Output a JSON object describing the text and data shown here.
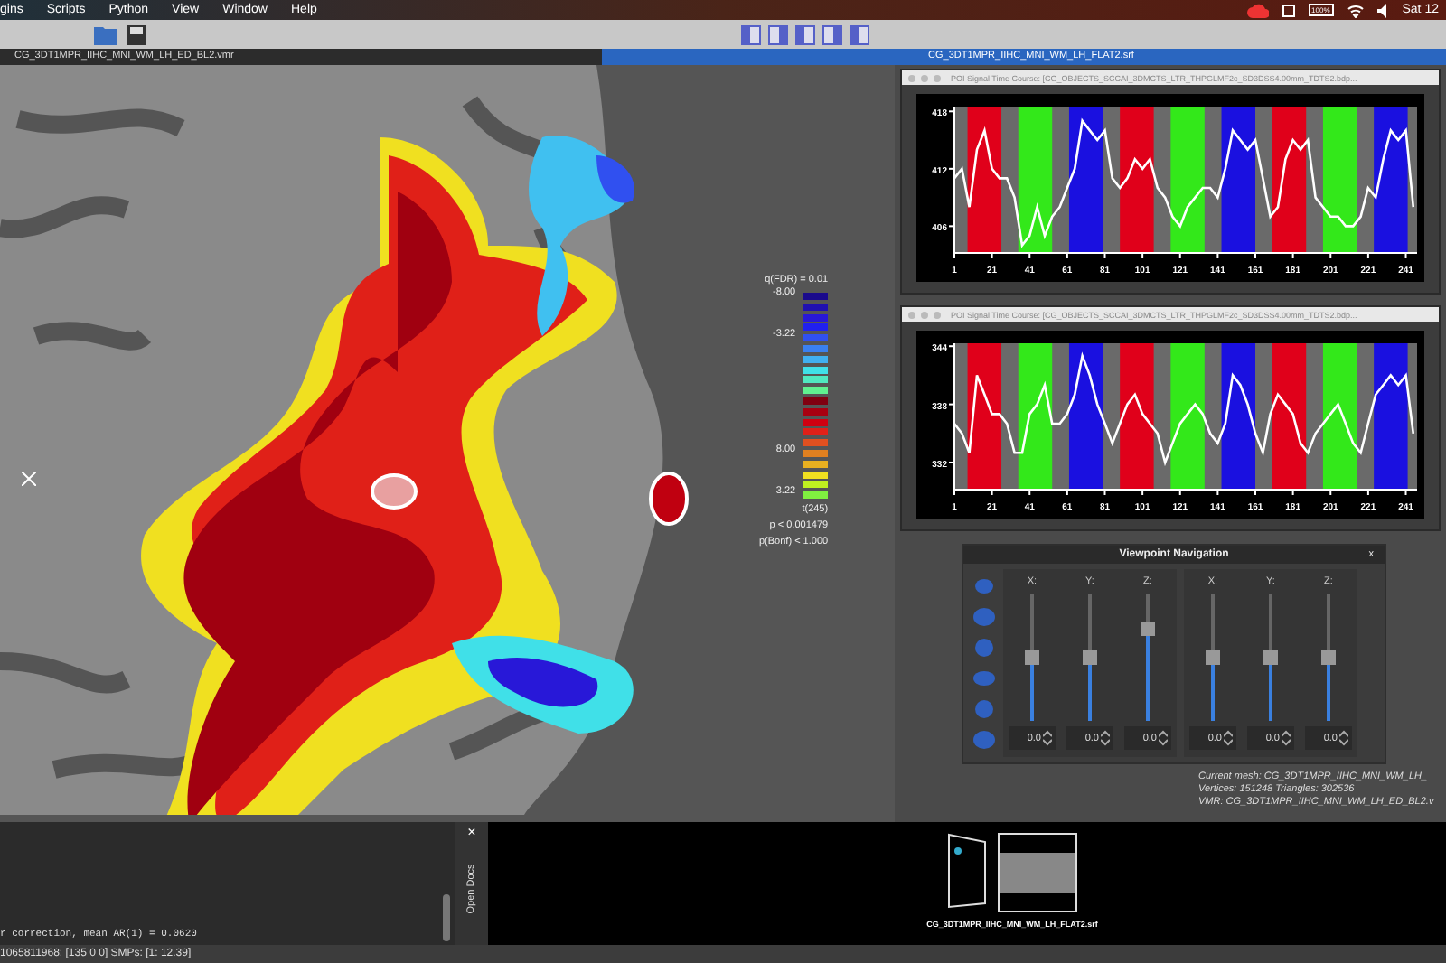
{
  "menu_bar": {
    "items": [
      "gins",
      "Scripts",
      "Python",
      "View",
      "Window",
      "Help"
    ],
    "battery": "100%",
    "clock": "Sat 12"
  },
  "tabs": [
    {
      "label": "CG_3DT1MPR_IIHC_MNI_WM_LH_ED_BL2.vmr",
      "selected": false
    },
    {
      "label": "CG_3DT1MPR_IIHC_MNI_WM_LH_FLAT2.srf",
      "selected": true
    }
  ],
  "legend": {
    "title": "q(FDR) = 0.01",
    "neg_max": "-8.00",
    "neg_min": "-3.22",
    "pos_max": "8.00",
    "pos_min": "3.22",
    "dof": "t(245)",
    "p_value": "p < 0.001479",
    "bonferroni": "p(Bonf) < 1.000",
    "negative_colors": [
      {
        "color": "#1a0a8c"
      },
      {
        "color": "#2010b0"
      },
      {
        "color": "#2818d8"
      },
      {
        "color": "#2020f0"
      },
      {
        "color": "#3050f0"
      },
      {
        "color": "#3a80f0"
      },
      {
        "color": "#40b0f0"
      },
      {
        "color": "#40e0e8"
      },
      {
        "color": "#50e8c0"
      },
      {
        "color": "#60f090"
      }
    ],
    "positive_colors": [
      {
        "color": "#800010"
      },
      {
        "color": "#a80010"
      },
      {
        "color": "#d00010"
      },
      {
        "color": "#e02018"
      },
      {
        "color": "#e05020"
      },
      {
        "color": "#e08020"
      },
      {
        "color": "#e8b020"
      },
      {
        "color": "#f0e020"
      },
      {
        "color": "#c0f020"
      },
      {
        "color": "#80f040"
      }
    ]
  },
  "time_courses": [
    {
      "title": "POI Signal Time Course: [CG_OBJECTS_SCCAI_3DMCTS_LTR_THPGLMF2c_SD3DSS4.00mm_TDTS2.bdp...",
      "chart_data": {
        "type": "line",
        "xlim": [
          1,
          247
        ],
        "ylim": [
          403.2,
          418.5
        ],
        "yticks": [
          406,
          412,
          418
        ],
        "xticks": [
          1,
          21,
          41,
          61,
          81,
          101,
          121,
          141,
          161,
          181,
          201,
          221,
          241
        ],
        "x": [
          1,
          5,
          9,
          13,
          17,
          21,
          25,
          29,
          33,
          37,
          41,
          45,
          49,
          53,
          57,
          61,
          65,
          69,
          73,
          77,
          81,
          85,
          89,
          93,
          97,
          101,
          105,
          109,
          113,
          117,
          121,
          125,
          129,
          133,
          137,
          141,
          145,
          149,
          153,
          157,
          161,
          165,
          169,
          173,
          177,
          181,
          185,
          189,
          193,
          197,
          201,
          205,
          209,
          213,
          217,
          221,
          225,
          229,
          233,
          237,
          241,
          245
        ],
        "series": [
          {
            "color": "#ffffff",
            "values": [
              411,
              412,
              408,
              414,
              416,
              412,
              411,
              411,
              409,
              404,
              405,
              408,
              405,
              407,
              408,
              410,
              412,
              417,
              416,
              415,
              416,
              411,
              410,
              411,
              413,
              412,
              413,
              410,
              409,
              407,
              406,
              408,
              409,
              410,
              410,
              409,
              412,
              416,
              415,
              414,
              415,
              411,
              407,
              408,
              413,
              415,
              414,
              415,
              409,
              408,
              407,
              407,
              406,
              406,
              407,
              410,
              409,
              413,
              416,
              415,
              416,
              408
            ]
          }
        ]
      },
      "condition_blocks": [
        {
          "color": "#e0001a"
        },
        {
          "color": "#33e81a"
        },
        {
          "color": "#1a10e0"
        },
        {
          "color": "#e0001a"
        },
        {
          "color": "#33e81a"
        },
        {
          "color": "#1a10e0"
        },
        {
          "color": "#e0001a"
        },
        {
          "color": "#33e81a"
        },
        {
          "color": "#1a10e0"
        }
      ]
    },
    {
      "title": "POI Signal Time Course: [CG_OBJECTS_SCCAI_3DMCTS_LTR_THPGLMF2c_SD3DSS4.00mm_TDTS2.bdp...",
      "chart_data": {
        "type": "line",
        "xlim": [
          1,
          247
        ],
        "ylim": [
          329.2,
          344.3
        ],
        "yticks": [
          332,
          338,
          344
        ],
        "xticks": [
          1,
          21,
          41,
          61,
          81,
          101,
          121,
          141,
          161,
          181,
          201,
          221,
          241
        ],
        "x": [
          1,
          5,
          9,
          13,
          17,
          21,
          25,
          29,
          33,
          37,
          41,
          45,
          49,
          53,
          57,
          61,
          65,
          69,
          73,
          77,
          81,
          85,
          89,
          93,
          97,
          101,
          105,
          109,
          113,
          117,
          121,
          125,
          129,
          133,
          137,
          141,
          145,
          149,
          153,
          157,
          161,
          165,
          169,
          173,
          177,
          181,
          185,
          189,
          193,
          197,
          201,
          205,
          209,
          213,
          217,
          221,
          225,
          229,
          233,
          237,
          241,
          245
        ],
        "series": [
          {
            "color": "#ffffff",
            "values": [
              336,
              335,
              333,
              341,
              339,
              337,
              337,
              336,
              333,
              333,
              337,
              338,
              340,
              336,
              336,
              337,
              339,
              343,
              341,
              338,
              336,
              334,
              336,
              338,
              339,
              337,
              336,
              335,
              332,
              334,
              336,
              337,
              338,
              337,
              335,
              334,
              336,
              341,
              340,
              338,
              335,
              333,
              337,
              339,
              338,
              337,
              334,
              333,
              335,
              336,
              337,
              338,
              336,
              334,
              333,
              336,
              339,
              340,
              341,
              340,
              341,
              335
            ]
          }
        ]
      },
      "condition_blocks": [
        {
          "color": "#e0001a"
        },
        {
          "color": "#33e81a"
        },
        {
          "color": "#1a10e0"
        },
        {
          "color": "#e0001a"
        },
        {
          "color": "#33e81a"
        },
        {
          "color": "#1a10e0"
        },
        {
          "color": "#e0001a"
        },
        {
          "color": "#33e81a"
        },
        {
          "color": "#1a10e0"
        }
      ]
    }
  ],
  "viewpoint_navigation": {
    "title": "Viewpoint Navigation",
    "close": "x",
    "groups": [
      {
        "sliders": [
          {
            "label": "X:",
            "level": 0.5,
            "value": "0.0"
          },
          {
            "label": "Y:",
            "level": 0.5,
            "value": "0.0"
          },
          {
            "label": "Z:",
            "level": 0.73,
            "value": "0.0"
          }
        ]
      },
      {
        "sliders": [
          {
            "label": "X:",
            "level": 0.5,
            "value": "0.0"
          },
          {
            "label": "Y:",
            "level": 0.5,
            "value": "0.0"
          },
          {
            "label": "Z:",
            "level": 0.5,
            "value": "0.0"
          }
        ]
      }
    ]
  },
  "mesh_info": [
    "Current mesh: CG_3DT1MPR_IIHC_MNI_WM_LH_",
    "Vertices: 151248  Triangles: 302536",
    "VMR: CG_3DT1MPR_IIHC_MNI_WM_LH_ED_BL2.v"
  ],
  "log": {
    "line": "r correction, mean AR(1) = 0.0620"
  },
  "open_docs": {
    "label": "Open Docs",
    "close": "×",
    "document": "CG_3DT1MPR_IIHC_MNI_WM_LH_FLAT2.srf"
  },
  "status_bar": "1065811968: [135 0 0] SMPs: [1: 12.39]"
}
